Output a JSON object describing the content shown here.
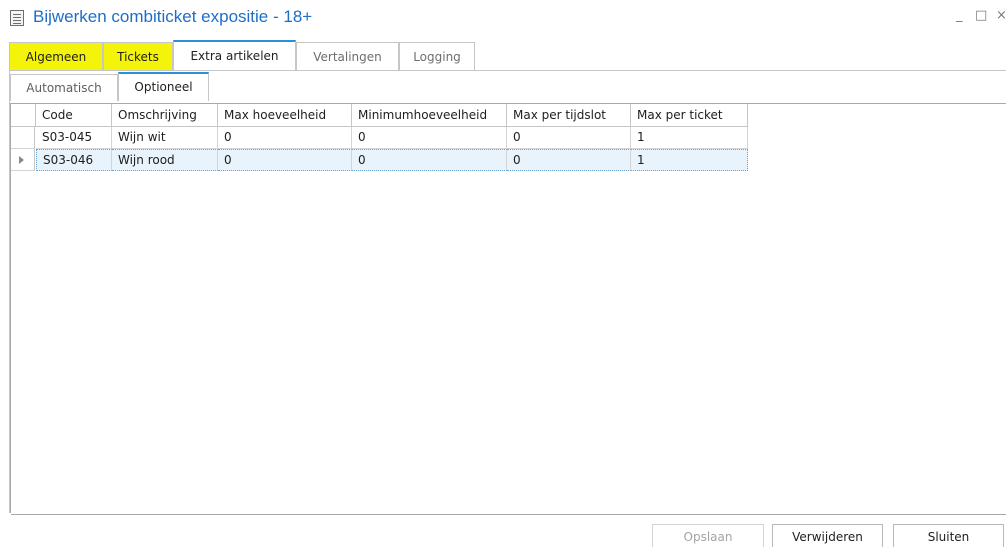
{
  "window": {
    "title": "Bijwerken combiticket expositie  - 18+",
    "minimize": "_",
    "maximize": "□",
    "close": "×"
  },
  "main_tabs": [
    {
      "label": "Algemeen"
    },
    {
      "label": "Tickets"
    },
    {
      "label": "Extra artikelen"
    },
    {
      "label": "Vertalingen"
    },
    {
      "label": "Logging"
    }
  ],
  "sub_tabs": [
    {
      "label": "Automatisch"
    },
    {
      "label": "Optioneel"
    }
  ],
  "grid": {
    "columns": [
      "Code",
      "Omschrijving",
      "Max hoeveelheid",
      "Minimumhoeveelheid",
      "Max per tijdslot",
      "Max per ticket"
    ],
    "rows": [
      [
        "S03-045",
        "Wijn wit",
        "0",
        "0",
        "0",
        "1"
      ],
      [
        "S03-046",
        "Wijn rood",
        "0",
        "0",
        "0",
        "1"
      ]
    ]
  },
  "buttons": {
    "save": "Opslaan",
    "delete": "Verwijderen",
    "close": "Sluiten"
  },
  "colors": {
    "title": "#1e6ec8",
    "highlight_tab": "#f4f40a",
    "active_tab_accent": "#2b8fd6",
    "selected_row": "#e8f3fb"
  }
}
